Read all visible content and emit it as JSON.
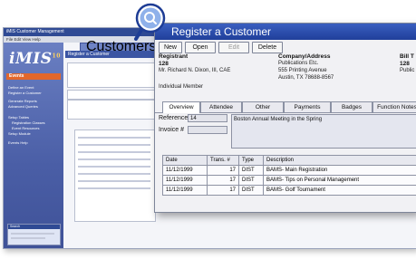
{
  "background_app": {
    "title_bar": "iMIS Customer Management",
    "menu": "File  Edit  View  Help",
    "logo": "iMIS",
    "logo_version": "10",
    "section_title": "Events",
    "sidebar_links": [
      "Define an Event",
      "Register a Customer",
      "Generate Reports",
      "Advanced Queries",
      "Setup Tables",
      "Registration Classes",
      "Event Resources",
      "Setup Module",
      "Events Help"
    ],
    "tabs": [
      "Customers"
    ],
    "bar_title": "Register a Customer",
    "mini_panel_title": "Search"
  },
  "window": {
    "title": "Register a Customer",
    "buttons": [
      {
        "label": "New",
        "enabled": true
      },
      {
        "label": "Open",
        "enabled": true
      },
      {
        "label": "Edit",
        "enabled": false
      },
      {
        "label": "Delete",
        "enabled": true
      }
    ]
  },
  "registrant": {
    "label": "Registrant",
    "id": "128",
    "name": "Mr. Richard N. Dixon, III, CAE",
    "member_type": "Individual Member"
  },
  "company": {
    "label": "Company/Address",
    "name": "Publications Etc.",
    "street": "555 Printing Avenue",
    "city": "Austin, TX  78688-8567"
  },
  "bill_to": {
    "label": "Bill T",
    "id": "128",
    "name": "Public"
  },
  "tabs": [
    "Overview",
    "Attendee",
    "Other",
    "Payments",
    "Badges",
    "Function Notes"
  ],
  "active_tab": "Overview",
  "fields": {
    "reference_label": "Reference",
    "reference_value": "14",
    "invoice_label": "Invoice #",
    "invoice_value": "",
    "description": "Boston Annual Meeting in the Spring"
  },
  "grid": {
    "columns": [
      "Date",
      "Trans. #",
      "Type",
      "Description"
    ],
    "rows": [
      [
        "11/12/1999",
        "17",
        "DIST",
        "BAMS- Main Registration"
      ],
      [
        "11/12/1999",
        "17",
        "DIST",
        "BAMS- Tips on Personal Management"
      ],
      [
        "11/12/1999",
        "17",
        "DIST",
        "BAMS- Golf Tournament"
      ]
    ]
  },
  "colors": {
    "title_bar": "#2d4fae",
    "sidebar": "#4a5ea6",
    "accent": "#e2672b"
  }
}
